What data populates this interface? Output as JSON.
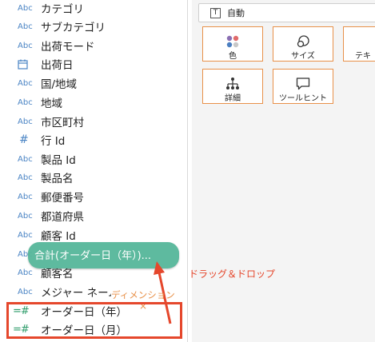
{
  "fields": [
    {
      "type_icon": "Abc",
      "label": "カテゴリ"
    },
    {
      "type_icon": "Abc",
      "label": "サブカテゴリ"
    },
    {
      "type_icon": "Abc",
      "label": "出荷モード"
    },
    {
      "type_icon": "calendar-icon",
      "label": "出荷日"
    },
    {
      "type_icon": "Abc",
      "label": "国/地域"
    },
    {
      "type_icon": "Abc",
      "label": "地域"
    },
    {
      "type_icon": "Abc",
      "label": "市区町村"
    },
    {
      "type_icon": "#",
      "label": "行 Id"
    },
    {
      "type_icon": "Abc",
      "label": "製品 Id"
    },
    {
      "type_icon": "Abc",
      "label": "製品名"
    },
    {
      "type_icon": "Abc",
      "label": "郵便番号"
    },
    {
      "type_icon": "Abc",
      "label": "都道府県"
    },
    {
      "type_icon": "Abc",
      "label": "顧客 Id"
    },
    {
      "type_icon": "Abc",
      "label": ""
    },
    {
      "type_icon": "Abc",
      "label": "顧客名"
    },
    {
      "type_icon": "Abc",
      "label": "メジャー ネーム"
    },
    {
      "type_icon": "=#",
      "label": "オーダー日（年）"
    },
    {
      "type_icon": "=#",
      "label": "オーダー日（月）"
    }
  ],
  "marks": {
    "type_label": "自動",
    "buttons": [
      {
        "label": "色",
        "icon": "color-dots-icon"
      },
      {
        "label": "サイズ",
        "icon": "size-icon"
      },
      {
        "label": "テキ",
        "icon": "text-icon"
      },
      {
        "label": "詳細",
        "icon": "detail-icon"
      },
      {
        "label": "ツールヒント",
        "icon": "tooltip-icon"
      }
    ]
  },
  "drag_pill": {
    "label": "合計(オーダー日（年）)..."
  },
  "annotations": {
    "drag_drop": "ドラッグ＆ドロップ",
    "dimension": "ディメンション",
    "x_mark": "×"
  },
  "colors": {
    "accent_red": "#e5472c",
    "accent_orange": "#e8914a",
    "pill_green": "#56b79a",
    "dimension_blue": "#4a84c4"
  }
}
